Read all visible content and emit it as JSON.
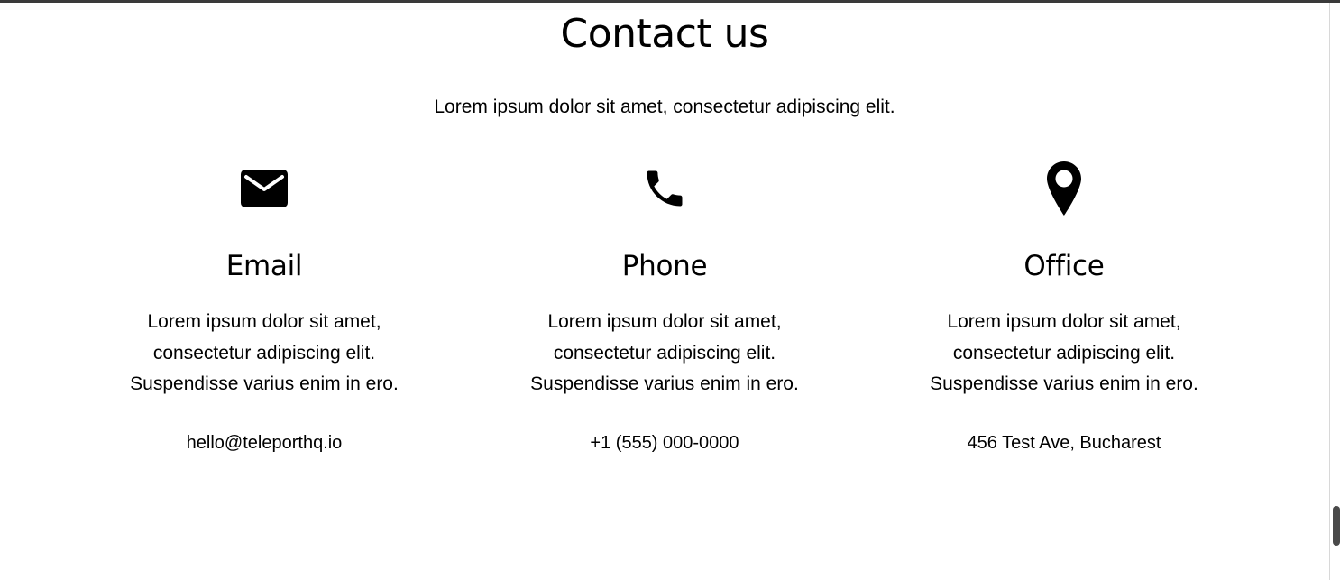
{
  "section": {
    "title": "Contact us",
    "subtitle": "Lorem ipsum dolor sit amet, consectetur adipiscing elit."
  },
  "cards": [
    {
      "icon": "mail-icon",
      "title": "Email",
      "description_lines": [
        "Lorem ipsum dolor sit amet,",
        "consectetur adipiscing elit.",
        "Suspendisse varius enim in ero."
      ],
      "contact": "hello@teleporthq.io"
    },
    {
      "icon": "phone-icon",
      "title": "Phone",
      "description_lines": [
        "Lorem ipsum dolor sit amet,",
        "consectetur adipiscing elit.",
        "Suspendisse varius enim in ero."
      ],
      "contact": "+1 (555) 000-0000"
    },
    {
      "icon": "map-pin-icon",
      "title": "Office",
      "description_lines": [
        "Lorem ipsum dolor sit amet,",
        "consectetur adipiscing elit.",
        "Suspendisse varius enim in ero."
      ],
      "contact": "456 Test Ave, Bucharest"
    }
  ],
  "colors": {
    "text": "#000000",
    "background": "#ffffff",
    "scroll_thumb": "#4a4a4a"
  }
}
